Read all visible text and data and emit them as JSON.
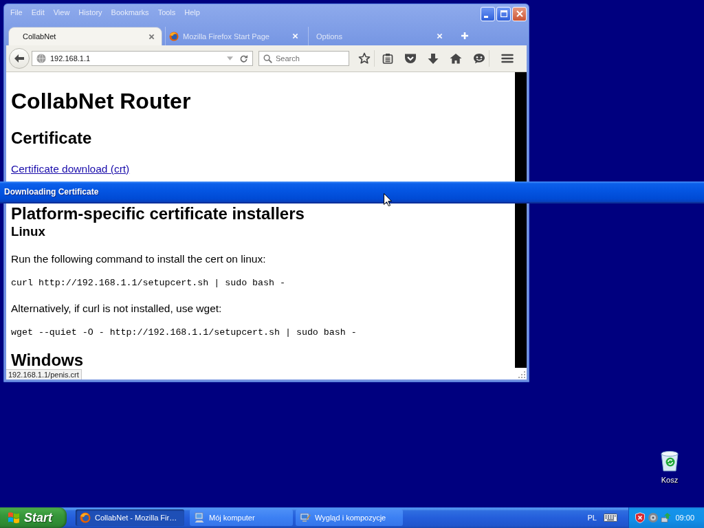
{
  "browser_window": {
    "menu": [
      "File",
      "Edit",
      "View",
      "History",
      "Bookmarks",
      "Tools",
      "Help"
    ],
    "tabs": [
      {
        "label": "CollabNet",
        "selected": true,
        "favicon": false
      },
      {
        "label": "Mozilla Firefox Start Page",
        "selected": false,
        "favicon": true
      },
      {
        "label": "Options",
        "selected": false,
        "favicon": false
      }
    ],
    "address_bar": {
      "value": "192.168.1.1"
    },
    "search": {
      "placeholder": "Search"
    },
    "page": [
      {
        "kind": "title",
        "text": "CollabNet Router"
      },
      {
        "kind": "heading",
        "text": "Certificate"
      },
      {
        "kind": "link",
        "text": "Certificate download (crt)"
      },
      {
        "kind": "heading",
        "text": "Platform-specific certificate installers"
      },
      {
        "kind": "subheading",
        "text": "Linux"
      },
      {
        "kind": "text",
        "text": "Run the following command to install the cert on linux:"
      },
      {
        "kind": "code",
        "text": "curl http://192.168.1.1/setupcert.sh | sudo bash -"
      },
      {
        "kind": "text",
        "text": "Alternatively, if curl is not installed, use wget:"
      },
      {
        "kind": "code",
        "text": "wget --quiet -O - http://192.168.1.1/setupcert.sh | sudo bash -"
      },
      {
        "kind": "heading",
        "text": "Windows"
      }
    ],
    "status_link": "192.168.1.1/penis.crt"
  },
  "download_window": {
    "title": "Downloading Certificate"
  },
  "desktop_icons": [
    {
      "kind": "recycle-bin",
      "label": "Kosz"
    }
  ],
  "taskbar": {
    "start": "Start",
    "tasks": [
      {
        "kind": "browser",
        "label": "CollabNet - Mozilla Fir…",
        "selected": true
      },
      {
        "kind": "computer",
        "label": "Mój komputer",
        "selected": false
      },
      {
        "kind": "appearance",
        "label": "Wygląd i kompozycje",
        "selected": false
      }
    ],
    "language": "PL",
    "clock": "09:00"
  }
}
